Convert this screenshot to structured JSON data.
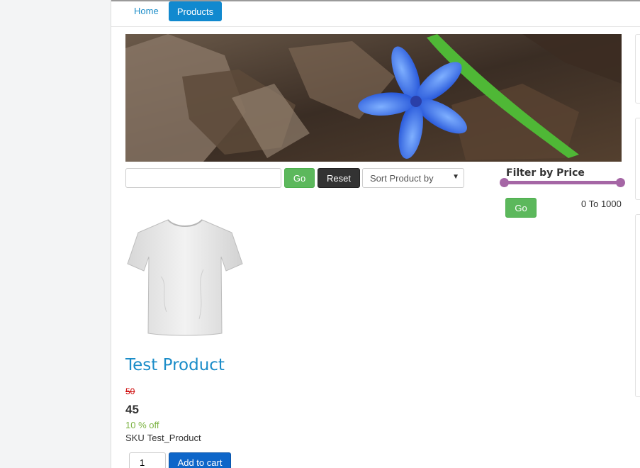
{
  "nav": {
    "home_label": "Home",
    "products_label": "Products"
  },
  "search": {
    "value": "",
    "go_label": "Go",
    "reset_label": "Reset",
    "sort_label": "Sort Product by"
  },
  "filter": {
    "title": "Filter by Price",
    "go_label": "Go",
    "range_text": "0 To 1000",
    "min": 0,
    "max": 1000,
    "accent_color": "#a566a5"
  },
  "product": {
    "title": "Test Product",
    "old_price": "50",
    "new_price": "45",
    "discount": "10 % off",
    "sku_label": "SKU",
    "sku_value": "Test_Product",
    "quantity": "1",
    "add_to_cart_label": "Add to cart"
  },
  "colors": {
    "link": "#1a8cc8",
    "primary": "#1189cf",
    "success": "#5cb85c",
    "dark": "#333333",
    "cart_button": "#0e66c9",
    "discount": "#7cb342",
    "old_price": "#cc0000"
  }
}
